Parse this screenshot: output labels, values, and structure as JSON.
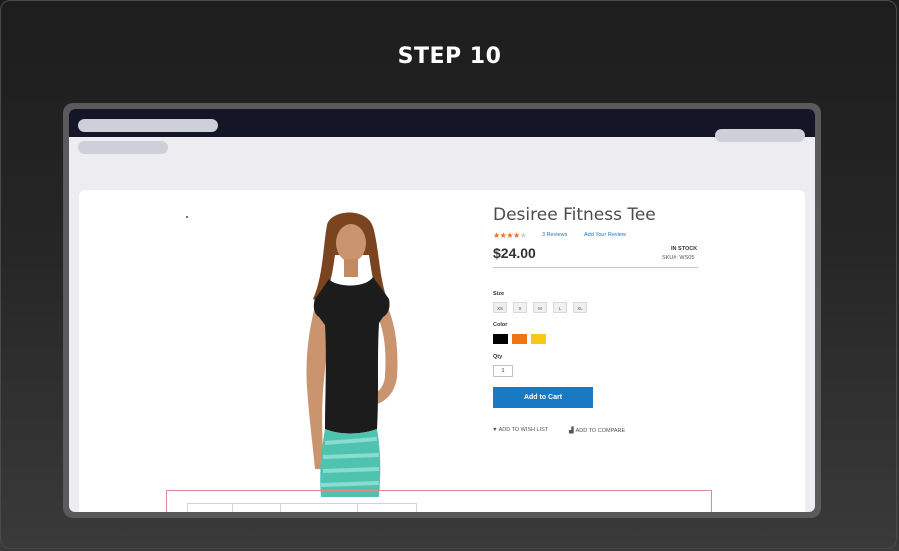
{
  "step": {
    "title": "STEP 10"
  },
  "browser": {
    "dots": [
      {
        "name": "blue",
        "color": "#2f63f0"
      },
      {
        "name": "orange",
        "color": "#f16a1b"
      },
      {
        "name": "yellow",
        "color": "#f5b51b"
      }
    ]
  },
  "product": {
    "name": "Desiree Fitness Tee",
    "rating_stars": 4,
    "rating_max": 5,
    "reviews_link": "3  Reviews",
    "add_review_link": "Add Your Review",
    "price": "$24.00",
    "stock": "IN STOCK",
    "sku": "SKU#:   WS05",
    "size_label": "Size",
    "sizes": [
      "XS",
      "S",
      "M",
      "L",
      "XL"
    ],
    "color_label": "Color",
    "colors": [
      "#000000",
      "#f07314",
      "#f8c814"
    ],
    "qty_label": "Qty",
    "qty_value": "1",
    "add_to_cart": "Add to Cart",
    "wishlist": "ADD TO WISH LIST",
    "compare": "ADD TO COMPARE",
    "icons": {
      "wishlist": "heart-icon",
      "compare": "bar-chart-icon"
    }
  },
  "theme": {
    "accent": "#1979c3",
    "star": "#f26c1b"
  }
}
